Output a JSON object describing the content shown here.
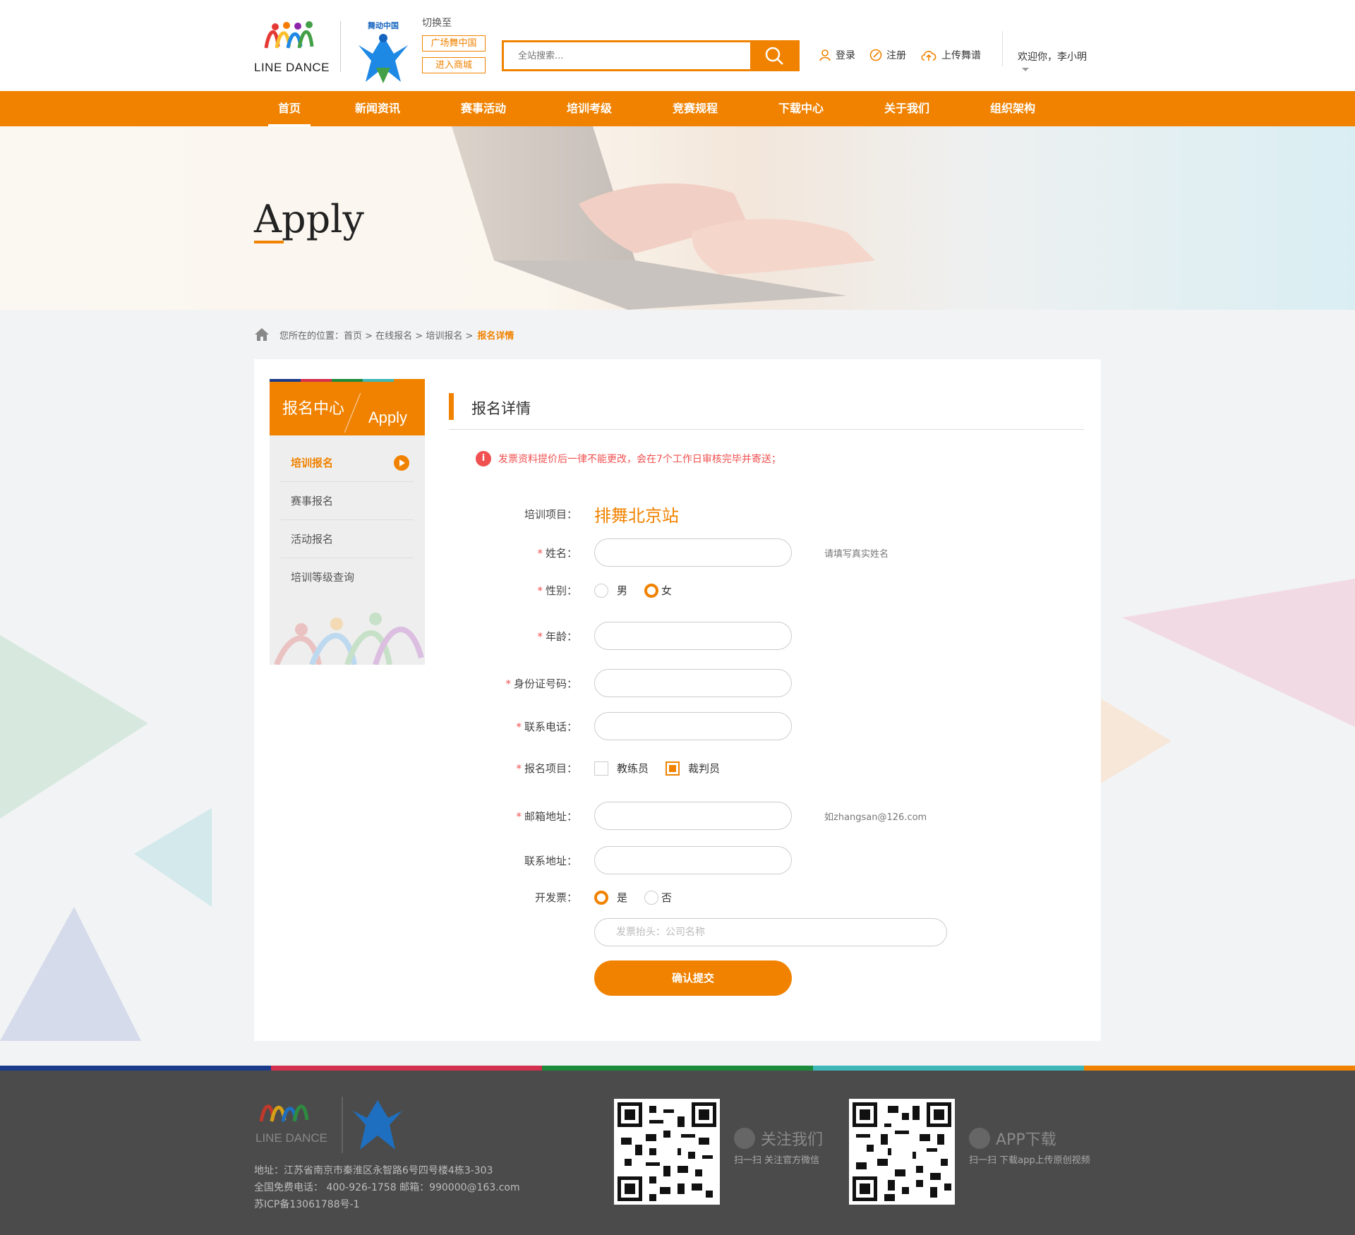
{
  "header": {
    "logo_text": "LINE DANCE",
    "logo2_text": "舞动中国",
    "switch_label": "切换至",
    "switch_btn1": "广场舞中国",
    "switch_btn2": "进入商城",
    "search_placeholder": "全站搜索...",
    "login": "登录",
    "register": "注册",
    "upload": "上传舞谱",
    "welcome": "欢迎你，李小明"
  },
  "nav": [
    "首页",
    "新闻资讯",
    "赛事活动",
    "培训考级",
    "竞赛规程",
    "下载中心",
    "关于我们",
    "组织架构"
  ],
  "banner": {
    "title": "Apply"
  },
  "breadcrumb": {
    "prefix": "您所在的位置：首页 > 在线报名 > 培训报名 >",
    "current": "报名详情"
  },
  "sidebar": {
    "title_cn": "报名中心",
    "title_en": "Apply",
    "items": [
      "培训报名",
      "赛事报名",
      "活动报名",
      "培训等级查询"
    ]
  },
  "main": {
    "title": "报名详情",
    "notice": "发票资料提价后一律不能更改，会在7个工作日审核完毕并寄送；",
    "fields": {
      "project_label": "培训项目：",
      "project_value": "排舞北京站",
      "name_label": "姓名：",
      "name_hint": "请填写真实姓名",
      "gender_label": "性别：",
      "gender_male": "男",
      "gender_female": "女",
      "age_label": "年龄：",
      "id_label": "身份证号码：",
      "phone_label": "联系电话：",
      "item_label": "报名项目：",
      "item_coach": "教练员",
      "item_referee": "裁判员",
      "email_label": "邮箱地址：",
      "email_hint": "如zhangsan@126.com",
      "address_label": "联系地址：",
      "invoice_label": "开发票：",
      "invoice_yes": "是",
      "invoice_no": "否",
      "invoice_placeholder": "发票抬头：公司名称",
      "submit": "确认提交"
    }
  },
  "footer": {
    "address": "地址：江苏省南京市秦淮区永智路6号四号楼4栋3-303",
    "phone": "全国免费电话： 400-926-1758    邮箱：990000@163.com",
    "icp": "苏ICP备13061788号-1",
    "follow_title": "关注我们",
    "follow_sub": "扫一扫 关注官方微信",
    "app_title": "APP下载",
    "app_sub": "扫一扫 下载app上传原创视频"
  },
  "colors": {
    "accent": "#f08200",
    "footer_bg": "#4b4b4b"
  }
}
